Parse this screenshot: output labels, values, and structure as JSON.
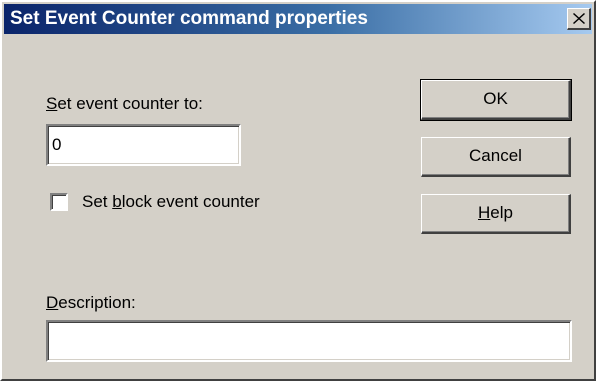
{
  "window": {
    "title": "Set Event Counter command properties",
    "close_icon": "close-icon"
  },
  "event_counter": {
    "label_prefix": "",
    "label_mnemonic": "S",
    "label_rest": "et event counter to:",
    "value": "0"
  },
  "block_checkbox": {
    "label_prefix": "Set ",
    "label_mnemonic": "b",
    "label_rest": "lock event counter",
    "checked": false
  },
  "description": {
    "label_prefix": "",
    "label_mnemonic": "D",
    "label_rest": "escription:",
    "value": ""
  },
  "buttons": {
    "ok": "OK",
    "cancel": "Cancel",
    "help_prefix": "",
    "help_mnemonic": "H",
    "help_rest": "elp"
  },
  "colors": {
    "face": "#d4d0c8",
    "titlebar_start": "#0a246a",
    "titlebar_end": "#a6caf0"
  }
}
